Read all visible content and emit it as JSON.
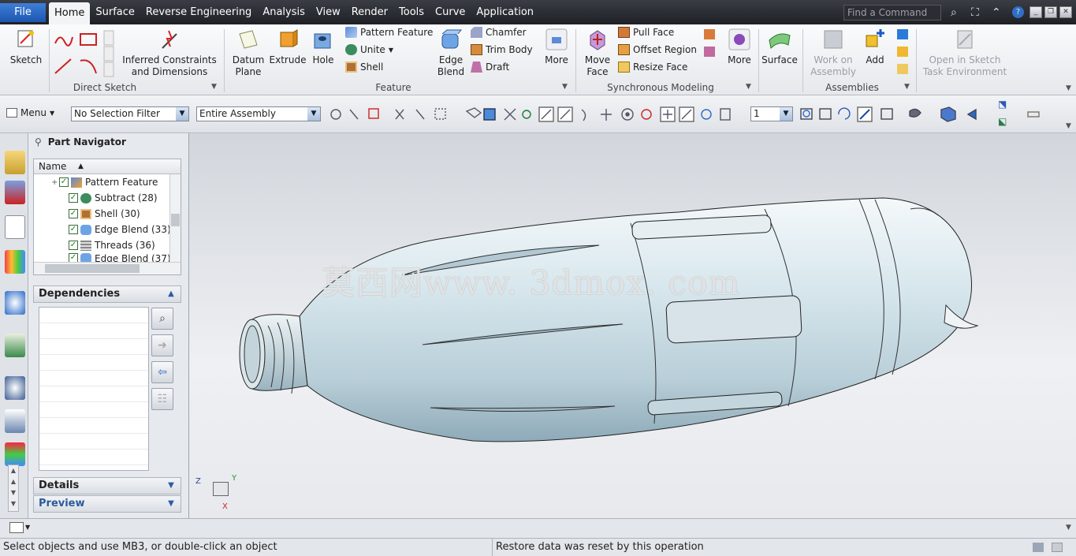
{
  "menu": {
    "file": "File",
    "tabs": [
      "Home",
      "Surface",
      "Reverse Engineering",
      "Analysis",
      "View",
      "Render",
      "Tools",
      "Curve",
      "Application"
    ],
    "active_tab": "Home",
    "search_placeholder": "Find a Command"
  },
  "ribbon": {
    "sketch": "Sketch",
    "inferred": [
      "Inferred Constraints",
      "and Dimensions"
    ],
    "direct_sketch_group": "Direct Sketch",
    "datum_plane": [
      "Datum",
      "Plane"
    ],
    "extrude": "Extrude",
    "hole": "Hole",
    "pattern_feature": "Pattern Feature",
    "unite": "Unite",
    "shell": "Shell",
    "edge_blend": [
      "Edge",
      "Blend"
    ],
    "chamfer": "Chamfer",
    "trim_body": "Trim Body",
    "draft": "Draft",
    "more1": "More",
    "feature_group": "Feature",
    "move_face": [
      "Move",
      "Face"
    ],
    "pull_face": "Pull Face",
    "offset_region": "Offset Region",
    "resize_face": "Resize Face",
    "more2": "More",
    "sync_group": "Synchronous Modeling",
    "surface": "Surface",
    "work_on_assembly": [
      "Work on",
      "Assembly"
    ],
    "add": "Add",
    "assemblies_group": "Assemblies",
    "open_sketch": [
      "Open in Sketch",
      "Task Environment"
    ]
  },
  "toolbar": {
    "menu": "Menu",
    "selection_filter": "No Selection Filter",
    "scope": "Entire Assembly",
    "layer": "1"
  },
  "navigator": {
    "title": "Part Navigator",
    "column": "Name",
    "items": [
      {
        "label": "Pattern Feature",
        "expand": "+"
      },
      {
        "label": "Subtract (28)"
      },
      {
        "label": "Shell (30)"
      },
      {
        "label": "Edge Blend (33)"
      },
      {
        "label": "Threads (36)"
      },
      {
        "label": "Edge Blend (37)"
      }
    ],
    "dependencies": "Dependencies",
    "details": "Details",
    "preview": "Preview"
  },
  "viewport": {
    "watermark": "莫西网www. 3dmox. com",
    "triad": {
      "z": "Z",
      "y": "Y",
      "x": "X"
    }
  },
  "status": {
    "left": "Select objects and use MB3, or double-click an object",
    "right": "Restore data was reset by this operation"
  },
  "colors": {
    "accent": "#1c55b0",
    "menubar": "#26292f",
    "model": "#c9dde6"
  }
}
